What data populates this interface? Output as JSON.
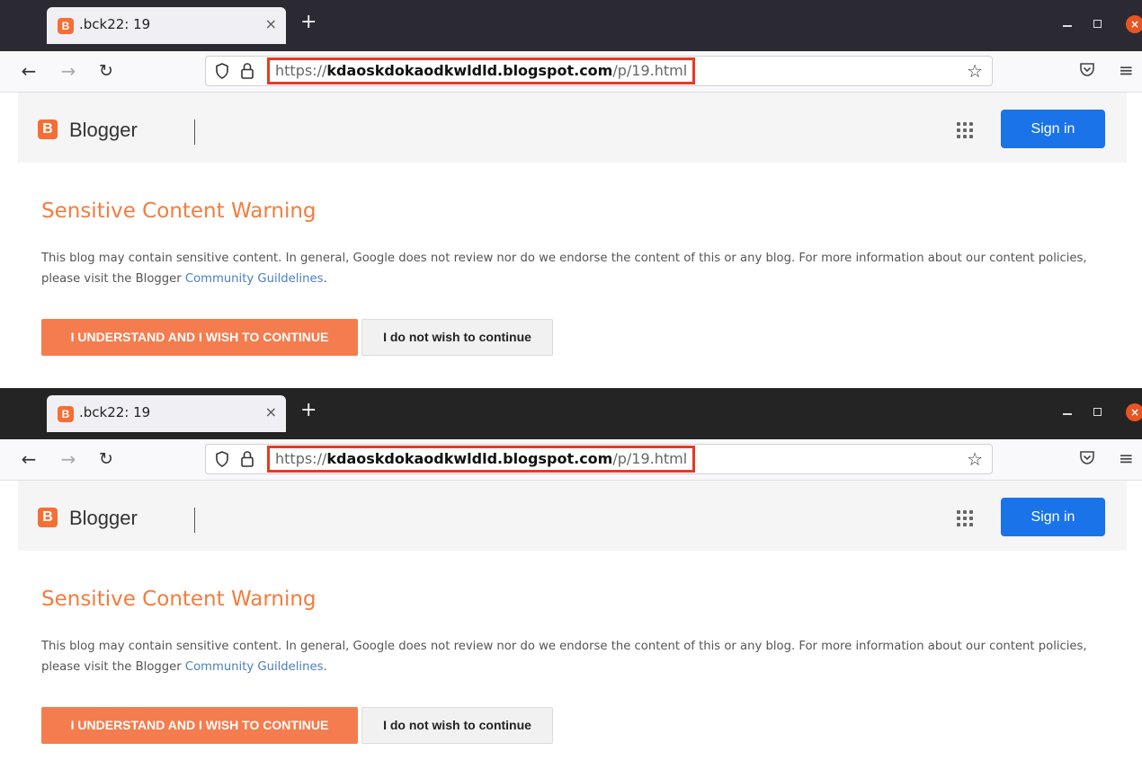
{
  "browser": {
    "tab_title": ".bck22: 19",
    "tab_close": "×",
    "new_tab": "+",
    "url_prefix": "https://",
    "url_domain": "kdaoskdokaodkwldld.blogspot.com",
    "url_path": "/p/19.html",
    "highlight_color": "#e53b22"
  },
  "blogger": {
    "logo_letter": "B",
    "brand": "Blogger",
    "signin_label": "Sign in",
    "accent_color": "#f57c3b",
    "signin_color": "#1a73e8"
  },
  "warning": {
    "title": "Sensitive Content Warning",
    "text_before_link": "This blog may contain sensitive content. In general, Google does not review nor do we endorse the content of this or any blog. For more information about our content policies, please visit the Blogger ",
    "link_text": "Community Guildelines",
    "text_after_link": ".",
    "continue_label": "I UNDERSTAND AND I WISH TO CONTINUE",
    "decline_label": "I do not wish to continue"
  },
  "icons": [
    "back-arrow-icon",
    "forward-arrow-icon",
    "reload-icon",
    "shield-icon",
    "lock-icon",
    "star-icon",
    "pocket-icon",
    "menu-icon",
    "apps-grid-icon"
  ]
}
